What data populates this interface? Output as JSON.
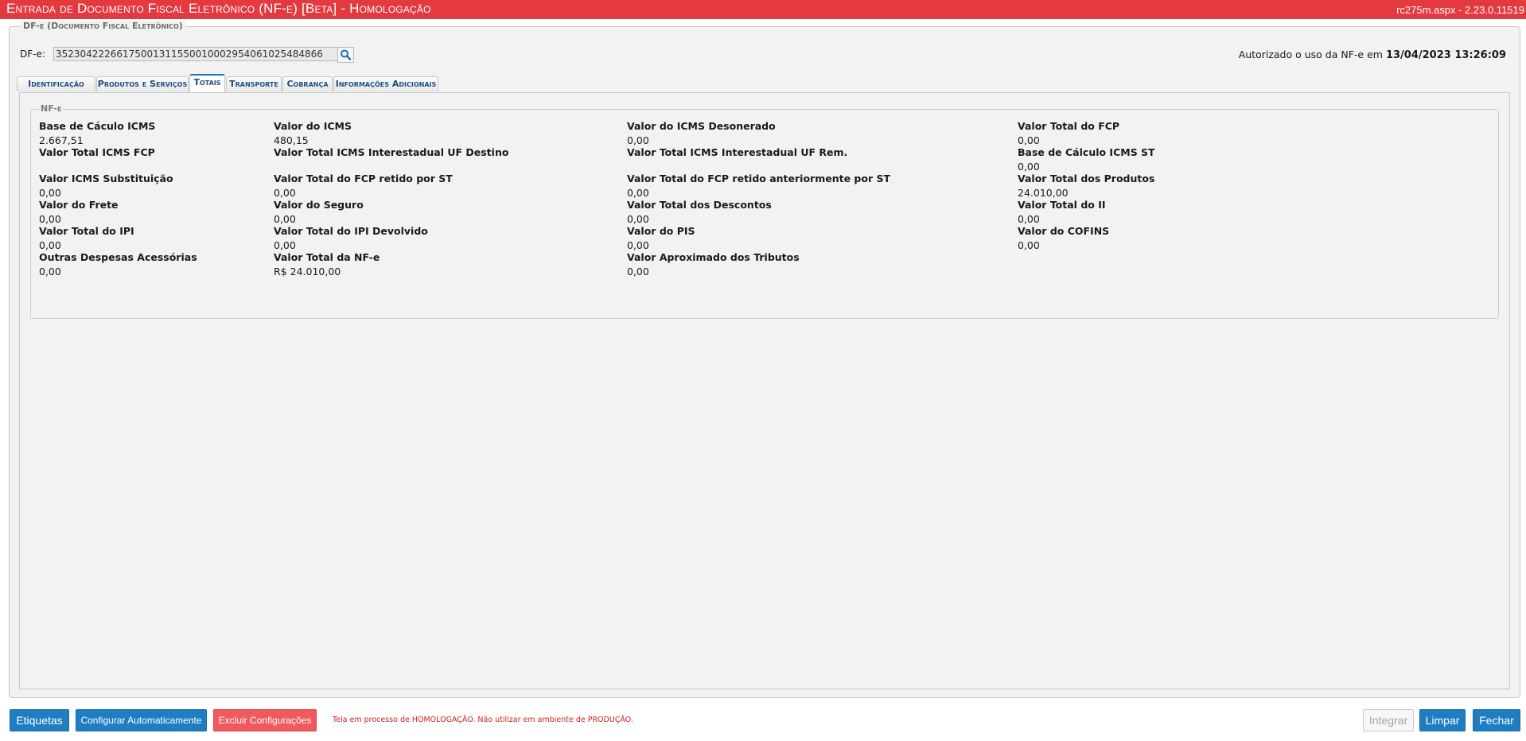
{
  "window": {
    "title": "Entrada de Documento Fiscal Eletrônico (NF-e) [Beta]  - Homologação",
    "version": "rc275m.aspx - 2.23.0.11519"
  },
  "dfe_section": {
    "legend": "DF-e (Documento Fiscal Eletrônico)",
    "label": "DF-e:",
    "key": "35230422266175001311550010002954061025484866",
    "status_prefix": "Autorizado o uso da NF-e em",
    "status_datetime": "13/04/2023 13:26:09"
  },
  "tabs": [
    {
      "label": "Identificação",
      "active": false
    },
    {
      "label": "Produtos e Serviços",
      "active": false
    },
    {
      "label": "Totais",
      "active": true
    },
    {
      "label": "Transporte",
      "active": false
    },
    {
      "label": "Cobrança",
      "active": false
    },
    {
      "label": "Informações Adicionais",
      "active": false
    }
  ],
  "totais": {
    "legend": "NF-e",
    "fields": [
      {
        "label": "Base de Cáculo ICMS",
        "value": "2.667,51"
      },
      {
        "label": "Valor do ICMS",
        "value": "480,15"
      },
      {
        "label": "Valor do ICMS Desonerado",
        "value": "0,00"
      },
      {
        "label": "Valor Total do FCP",
        "value": "0,00"
      },
      {
        "label": "Valor Total ICMS FCP",
        "value": ""
      },
      {
        "label": "Valor Total ICMS Interestadual UF Destino",
        "value": ""
      },
      {
        "label": "Valor Total ICMS Interestadual UF Rem.",
        "value": ""
      },
      {
        "label": "Base de Cálculo ICMS ST",
        "value": "0,00"
      },
      {
        "label": "Valor ICMS Substituição",
        "value": "0,00"
      },
      {
        "label": "Valor Total do FCP retido por ST",
        "value": "0,00"
      },
      {
        "label": "Valor Total do FCP retido anteriormente por ST",
        "value": "0,00"
      },
      {
        "label": "Valor Total dos Produtos",
        "value": "24.010,00"
      },
      {
        "label": "Valor do Frete",
        "value": "0,00"
      },
      {
        "label": "Valor do Seguro",
        "value": "0,00"
      },
      {
        "label": "Valor Total dos Descontos",
        "value": "0,00"
      },
      {
        "label": "Valor Total do II",
        "value": "0,00"
      },
      {
        "label": "Valor Total do IPI",
        "value": "0,00"
      },
      {
        "label": "Valor Total do IPI Devolvido",
        "value": "0,00"
      },
      {
        "label": "Valor do PIS",
        "value": "0,00"
      },
      {
        "label": "Valor do COFINS",
        "value": "0,00"
      },
      {
        "label": "Outras Despesas Acessórias",
        "value": "0,00"
      },
      {
        "label": "Valor Total da NF-e",
        "value": "R$ 24.010,00"
      },
      {
        "label": "Valor Aproximado dos Tributos",
        "value": "0,00"
      }
    ]
  },
  "footer": {
    "etiquetas": "Etiquetas",
    "configurar": "Configurar Automaticamente",
    "excluir": "Excluir Configurações",
    "warning": "Tela em processo de HOMOLOGAÇÃO. Não utilizar em ambiente de PRODUÇÃO.",
    "integrar": "Integrar",
    "limpar": "Limpar",
    "fechar": "Fechar"
  },
  "colors": {
    "title_bar": "#e4393f",
    "primary_button": "#1f7ec2",
    "danger_button": "#f05a5e",
    "tab_text": "#1c4e80",
    "warning_text": "#d11f1f"
  },
  "icons": {
    "dfe_search": "magnifier-icon"
  }
}
